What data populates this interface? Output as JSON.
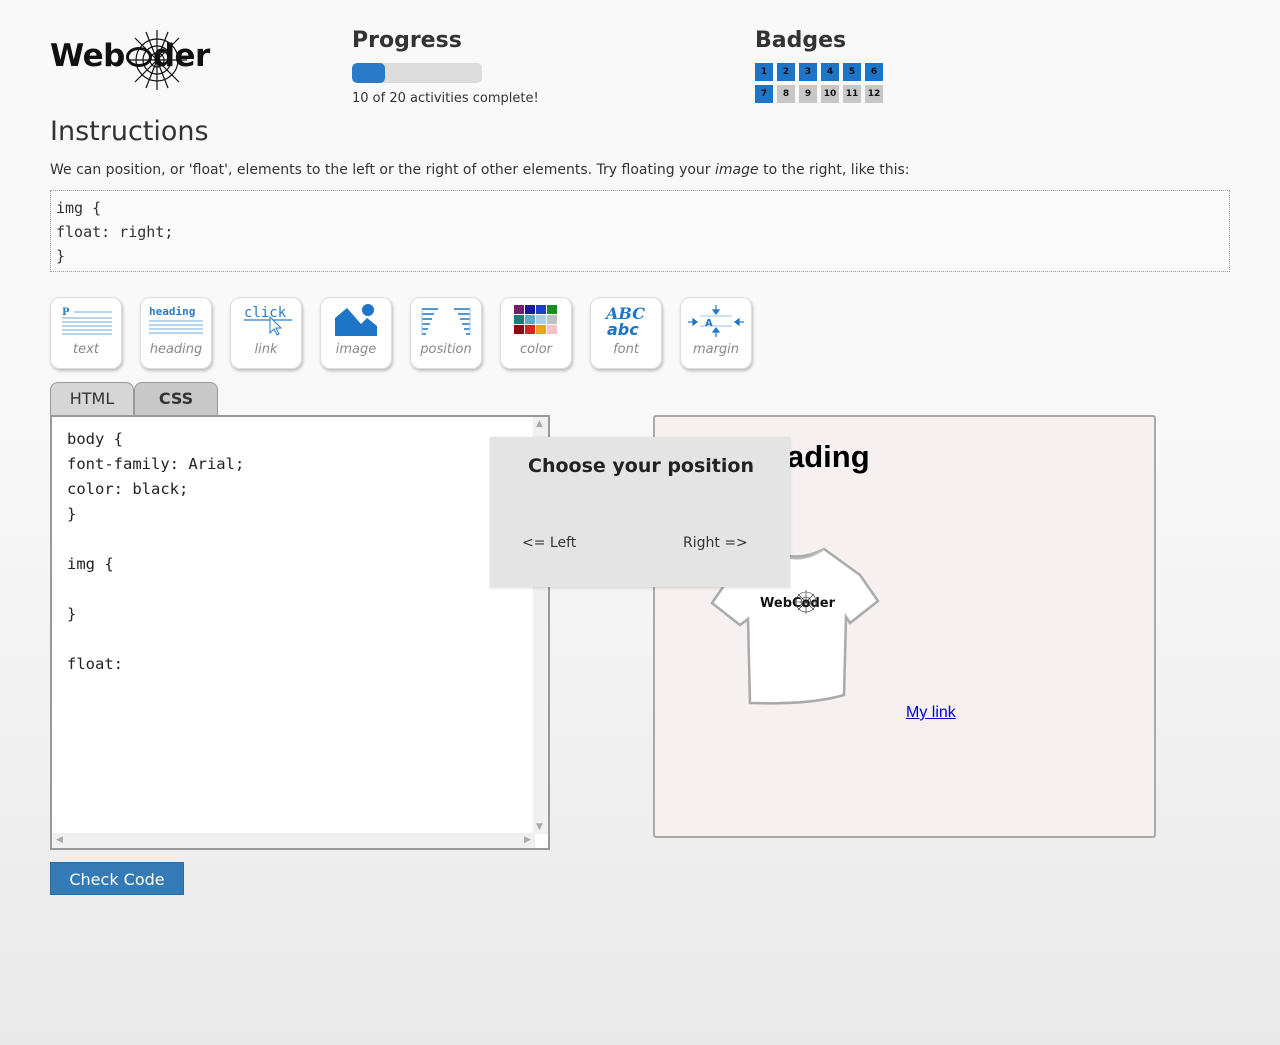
{
  "logo": {
    "text_left": "Web",
    "text_right": "der"
  },
  "progress": {
    "title": "Progress",
    "completed": 10,
    "total": 20,
    "fraction": 0.5,
    "status_text": "10 of 20 activities complete!"
  },
  "badges": {
    "title": "Badges",
    "items": [
      {
        "label": "1",
        "earned": true
      },
      {
        "label": "2",
        "earned": true
      },
      {
        "label": "3",
        "earned": true
      },
      {
        "label": "4",
        "earned": true
      },
      {
        "label": "5",
        "earned": true
      },
      {
        "label": "6",
        "earned": true
      },
      {
        "label": "7",
        "earned": true
      },
      {
        "label": "8",
        "earned": false
      },
      {
        "label": "9",
        "earned": false
      },
      {
        "label": "10",
        "earned": false
      },
      {
        "label": "11",
        "earned": false
      },
      {
        "label": "12",
        "earned": false
      }
    ]
  },
  "instructions": {
    "title": "Instructions",
    "text_before": "We can position, or 'float', elements to the left or the right of other elements. Try floating your ",
    "text_em": "image",
    "text_after": " to the right, like this:",
    "code_lines": [
      "img {",
      "float: right;",
      "}"
    ]
  },
  "tools": [
    {
      "label": "text",
      "icon": "paragraph-icon"
    },
    {
      "label": "heading",
      "icon": "heading-icon"
    },
    {
      "label": "link",
      "icon": "link-click-icon"
    },
    {
      "label": "image",
      "icon": "image-icon"
    },
    {
      "label": "position",
      "icon": "position-icon"
    },
    {
      "label": "color",
      "icon": "color-palette-icon"
    },
    {
      "label": "font",
      "icon": "font-icon"
    },
    {
      "label": "margin",
      "icon": "margin-icon"
    }
  ],
  "tool_icon_text": {
    "p": "P",
    "heading": "heading",
    "click": "click",
    "font_upper": "ABC",
    "font_lower": "abc",
    "margin_a": "A"
  },
  "tabs": [
    {
      "label": "HTML",
      "active": false
    },
    {
      "label": "CSS",
      "active": true
    }
  ],
  "editor": {
    "lines": [
      "body {",
      "font-family: Arial;",
      "color: black;",
      "}",
      "",
      "img {",
      "",
      "}",
      "",
      "float:"
    ]
  },
  "check_button": "Check Code",
  "preview": {
    "heading": "My heading",
    "heading_visible": "ading",
    "link": "My link",
    "shirt_logo": "WebCoder"
  },
  "modal": {
    "title": "Choose your position",
    "left_option": "<= Left",
    "right_option": "Right =>"
  },
  "colors": {
    "accent": "#337ab7",
    "progress_fill": "#2a7bc7",
    "badge_earned": "#1e74c7",
    "badge_locked": "#c7c7c7",
    "preview_bg": "#f6f0f0",
    "modal_bg": "#e4e4e4"
  }
}
